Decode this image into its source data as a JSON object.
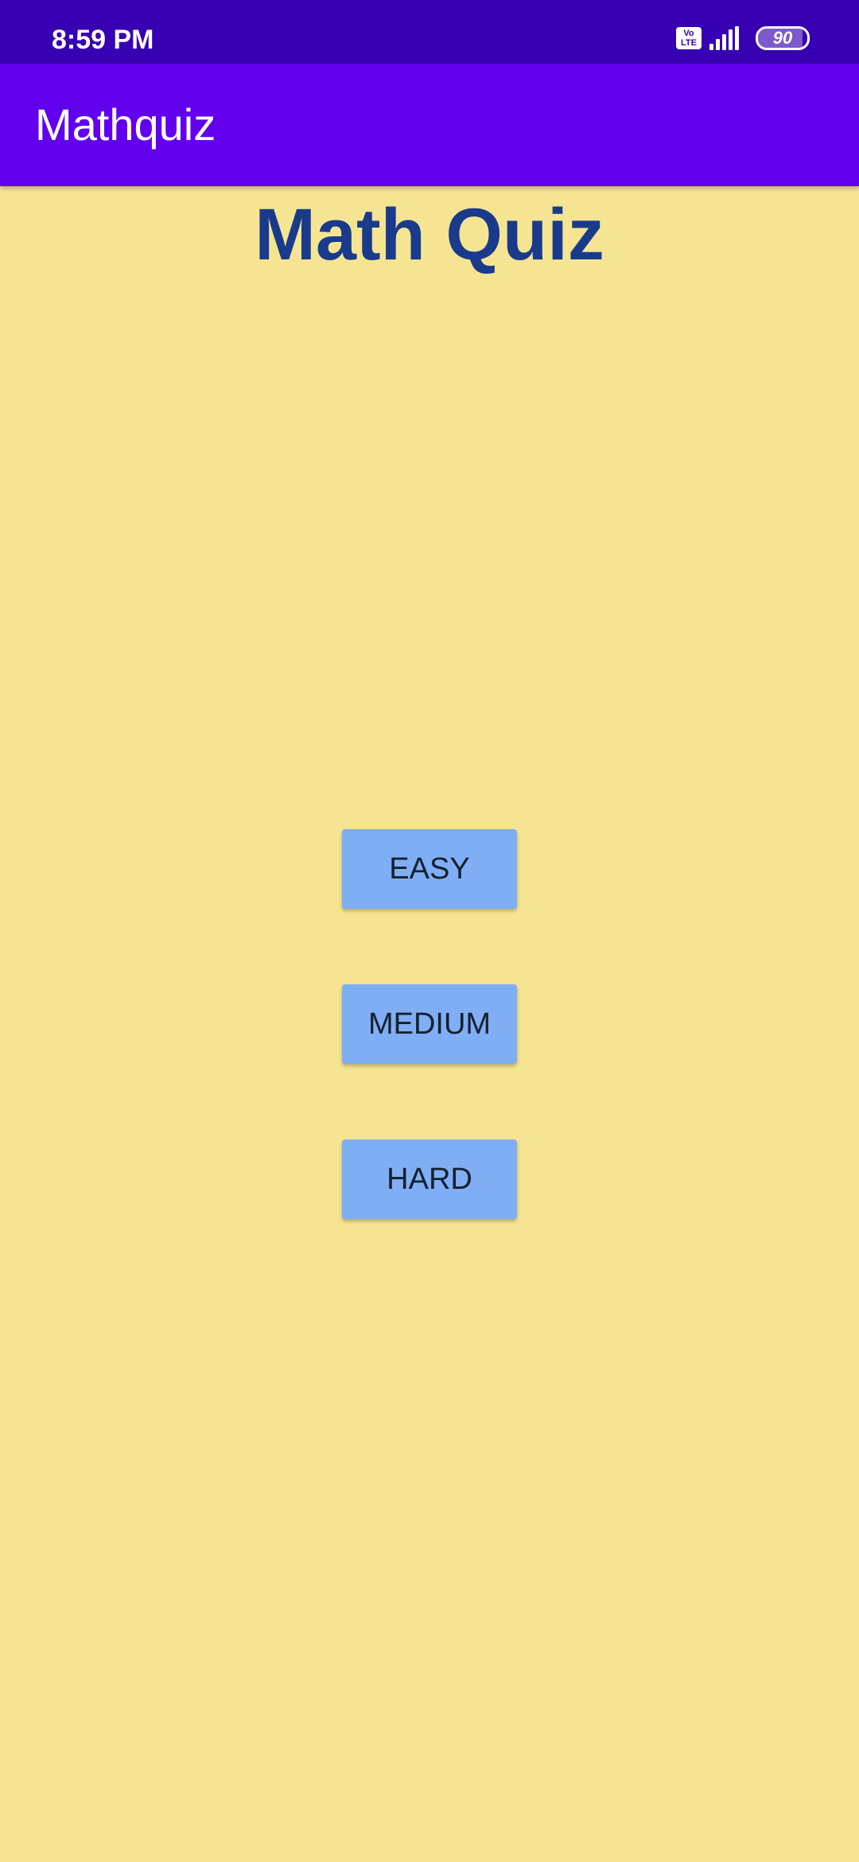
{
  "status_bar": {
    "time": "8:59 PM",
    "volte_top": "Vo",
    "volte_bottom": "LTE",
    "battery_level": "90"
  },
  "app_bar": {
    "title": "Mathquiz"
  },
  "main": {
    "heading": "Math Quiz",
    "buttons": [
      {
        "label": "EASY"
      },
      {
        "label": "MEDIUM"
      },
      {
        "label": "HARD"
      }
    ]
  },
  "colors": {
    "status_bar": "#3700b3",
    "app_bar": "#6200ee",
    "background": "#f5e592",
    "heading": "#1a3a8c",
    "button": "#80aef5"
  }
}
